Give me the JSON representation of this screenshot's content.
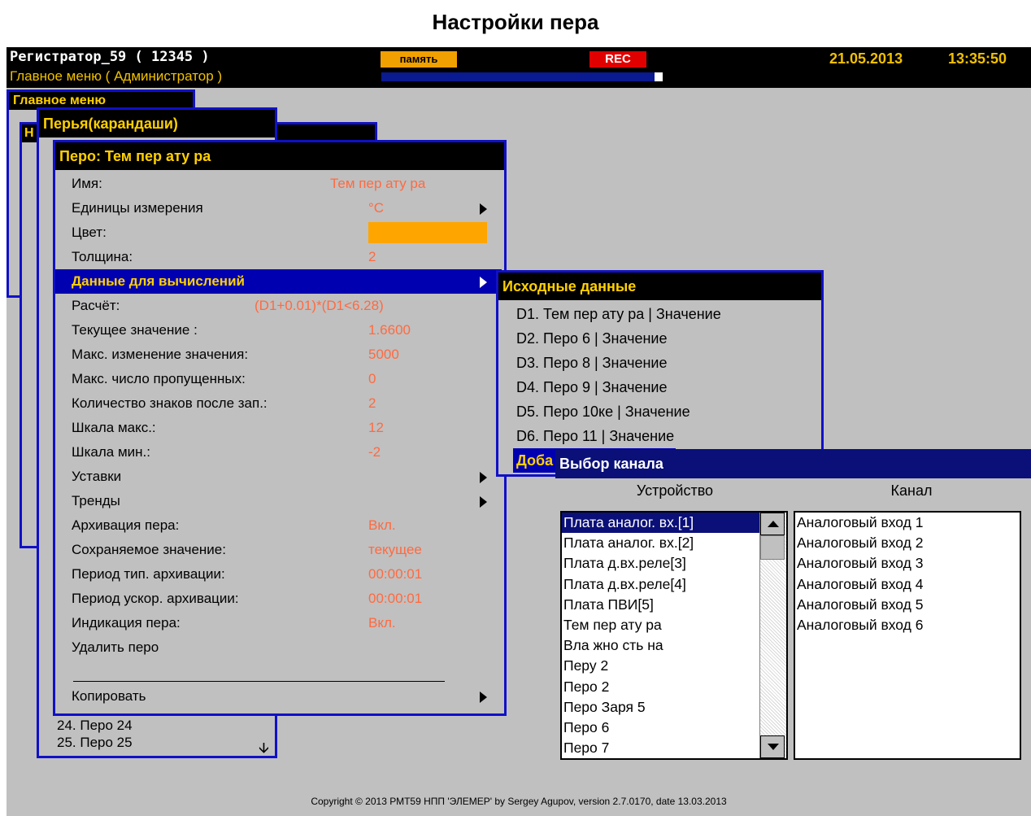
{
  "page": {
    "heading": "Настройки пера"
  },
  "topbar": {
    "device": "Регистратор_59 ( 12345 )",
    "menu_path": "Главное меню ( Администратор )",
    "memory_label": "память",
    "rec_label": "REC",
    "memory_fill_percent": 97,
    "date": "21.05.2013",
    "time": "13:35:50"
  },
  "main_menu": {
    "title": "Главное меню",
    "partial_letter": "Н"
  },
  "pens_window": {
    "title": "Перья(карандаши)",
    "items": [
      "24. Перо 24",
      "25. Перо 25"
    ]
  },
  "pen_window": {
    "title": "Перо: Тем пер ату ра",
    "color_value": "#ffa500",
    "rows": [
      {
        "label": "Имя:",
        "value": "Тем пер ату ра"
      },
      {
        "label": "Единицы измерения",
        "value": "°C"
      },
      {
        "label": "Цвет:",
        "value": ""
      },
      {
        "label": "Толщина:",
        "value": "2"
      },
      {
        "label": "Данные для вычислений",
        "value": ""
      },
      {
        "label": "Расчёт:",
        "value": "(D1+0.01)*(D1<6.28)"
      },
      {
        "label": "Текущее значение :",
        "value": "1.6600"
      },
      {
        "label": "Макс. изменение значения:",
        "value": "5000"
      },
      {
        "label": "Макс. число пропущенных:",
        "value": "0"
      },
      {
        "label": "Количество знаков после зап.:",
        "value": "2"
      },
      {
        "label": "Шкала макс.:",
        "value": "12"
      },
      {
        "label": "Шкала мин.:",
        "value": "-2"
      },
      {
        "label": "Уставки",
        "value": ""
      },
      {
        "label": "Тренды",
        "value": ""
      },
      {
        "label": "Архивация пера:",
        "value": "Вкл."
      },
      {
        "label": "Сохраняемое значение:",
        "value": "текущее"
      },
      {
        "label": "Период тип. архивации:",
        "value": "00:00:01"
      },
      {
        "label": "Период ускор. архивации:",
        "value": "00:00:01"
      },
      {
        "label": "Индикация пера:",
        "value": "Вкл."
      },
      {
        "label": "Удалить перо",
        "value": ""
      },
      {
        "label": "Копировать",
        "value": ""
      }
    ]
  },
  "source_window": {
    "title": "Исходные данные",
    "items": [
      "D1. Тем пер ату ра | Значение",
      "D2. Перо 6 | Значение",
      "D3. Перо 8 | Значение",
      "D4. Перо 9 | Значение",
      "D5. Перо 10ке | Значение",
      "D6. Перо 11 | Значение"
    ],
    "add_partial": "Доба"
  },
  "channel_dialog": {
    "title": "Выбор канала",
    "device_header": "Устройство",
    "channel_header": "Канал",
    "devices": [
      "Плата аналог. вх.[1]",
      "Плата аналог. вх.[2]",
      "Плата д.вх.реле[3]",
      "Плата д.вх.реле[4]",
      "Плата ПВИ[5]",
      "Тем пер ату ра",
      "Вла жно сть на",
      "Перу 2",
      "Перо 2",
      "Перо Заря 5",
      "Перо 6",
      "Перо 7"
    ],
    "channels": [
      "Аналоговый вход 1",
      "Аналоговый вход 2",
      "Аналоговый вход 3",
      "Аналоговый вход 4",
      "Аналоговый вход 5",
      "Аналоговый вход 6"
    ]
  },
  "footer": "Copyright © 2013 РМТ59 НПП 'ЭЛЕМЕР' by Sergey Agupov, version 2.7.0170, date 13.03.2013"
}
